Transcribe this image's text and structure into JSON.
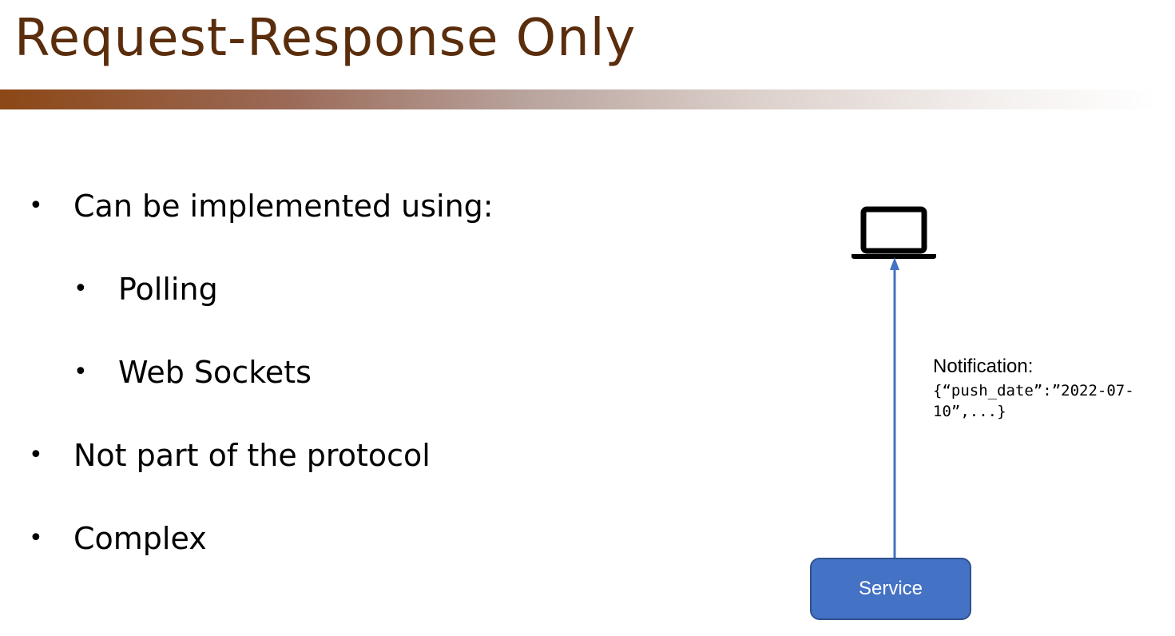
{
  "slide": {
    "title": "Request-Response Only"
  },
  "bullets": [
    {
      "text": "Can be implemented using:",
      "level": 1
    },
    {
      "text": "Polling",
      "level": 2
    },
    {
      "text": "Web Sockets",
      "level": 2
    },
    {
      "text": "Not part of the protocol",
      "level": 1
    },
    {
      "text": "Complex",
      "level": 1
    }
  ],
  "bullet_symbol": "•",
  "diagram": {
    "client_icon": "laptop-icon",
    "notification_label": "Notification:",
    "notification_payload": "{“push_date”:”2022-07-\n10”,...}",
    "service_label": "Service"
  },
  "colors": {
    "title": "#5a2d0c",
    "accent_bar_start": "#8c4716",
    "arrow": "#4472c4",
    "service_fill": "#4472c4",
    "service_border": "#2f528f"
  }
}
